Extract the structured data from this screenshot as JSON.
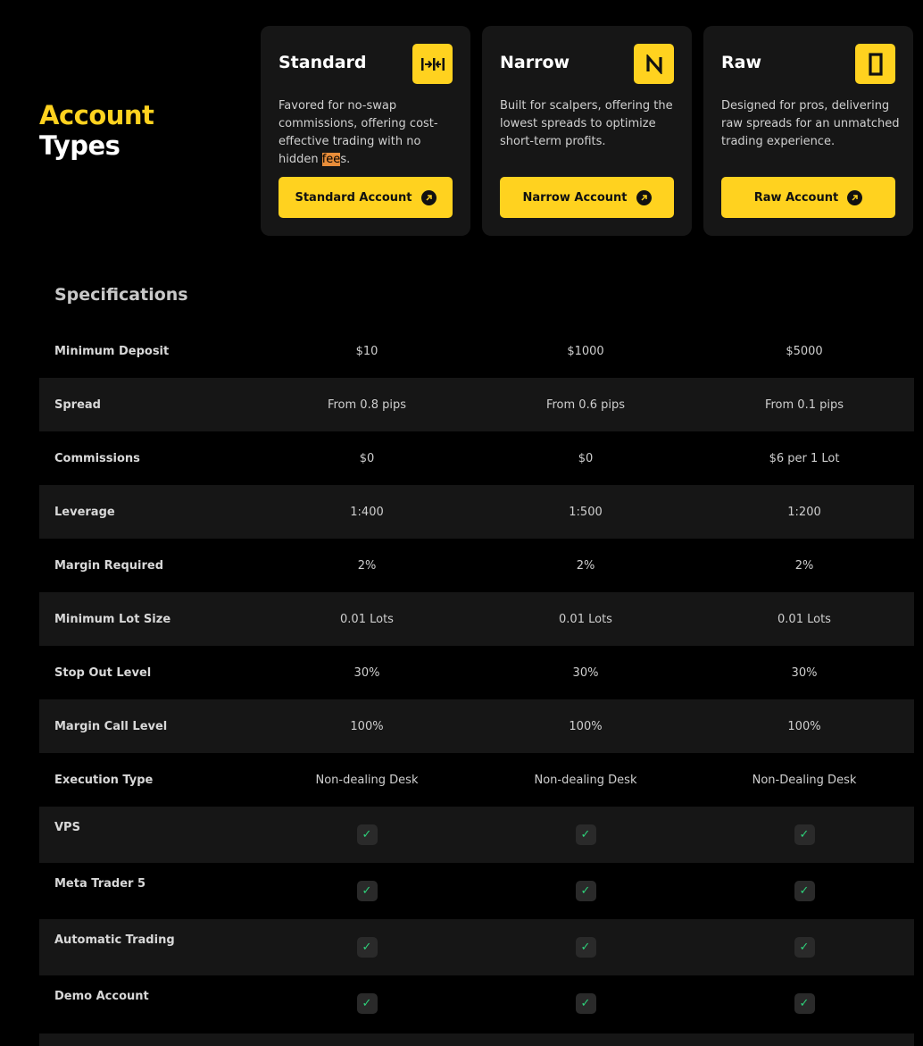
{
  "heading": {
    "line1": "Account",
    "line2": "Types"
  },
  "accounts": [
    {
      "name": "Standard",
      "icon": "spread-compress-icon",
      "description": "Favored for no-swap commissions, offering cost-effective trading with no hidden ",
      "description_highlight": "fee",
      "description_end": "s.",
      "cta": "Standard Account"
    },
    {
      "name": "Narrow",
      "icon": "letter-n-icon",
      "description": "Built for scalpers, offering the lowest spreads to optimize short-term profits.",
      "description_highlight": "",
      "description_end": "",
      "cta": "Narrow Account"
    },
    {
      "name": "Raw",
      "icon": "bar-rectangle-icon",
      "description": "Designed for pros, delivering raw spreads for an unmatched trading experience.",
      "description_highlight": "",
      "description_end": "",
      "cta": "Raw Account"
    }
  ],
  "specs": {
    "title": "Specifications",
    "rows": [
      {
        "label": "Minimum Deposit",
        "values": [
          "$10",
          "$1000",
          "$5000"
        ]
      },
      {
        "label": "Spread",
        "values": [
          "From 0.8 pips",
          "From 0.6 pips",
          "From 0.1 pips"
        ]
      },
      {
        "label": "Commissions",
        "values": [
          "$0",
          "$0",
          "$6 per 1 Lot"
        ]
      },
      {
        "label": "Leverage",
        "values": [
          "1:400",
          "1:500",
          "1:200"
        ]
      },
      {
        "label": "Margin Required",
        "values": [
          "2%",
          "2%",
          "2%"
        ]
      },
      {
        "label": "Minimum Lot Size",
        "values": [
          "0.01 Lots",
          "0.01 Lots",
          "0.01 Lots"
        ]
      },
      {
        "label": "Stop Out Level",
        "values": [
          "30%",
          "30%",
          "30%"
        ]
      },
      {
        "label": "Margin Call Level",
        "values": [
          "100%",
          "100%",
          "100%"
        ]
      },
      {
        "label": "Execution Type",
        "values": [
          "Non-dealing Desk",
          "Non-dealing Desk",
          "Non-Dealing Desk"
        ]
      }
    ],
    "check_rows": [
      {
        "label": "VPS",
        "values": [
          true,
          true,
          true
        ]
      },
      {
        "label": "Meta Trader 5",
        "values": [
          true,
          true,
          true
        ]
      },
      {
        "label": "Automatic Trading",
        "values": [
          true,
          true,
          true
        ]
      },
      {
        "label": "Demo Account",
        "values": [
          true,
          true,
          true
        ]
      }
    ],
    "check_glyph": "✓"
  },
  "colors": {
    "accent": "#ffd21f",
    "background": "#000000",
    "card": "#161616",
    "check": "#2ed17a"
  }
}
